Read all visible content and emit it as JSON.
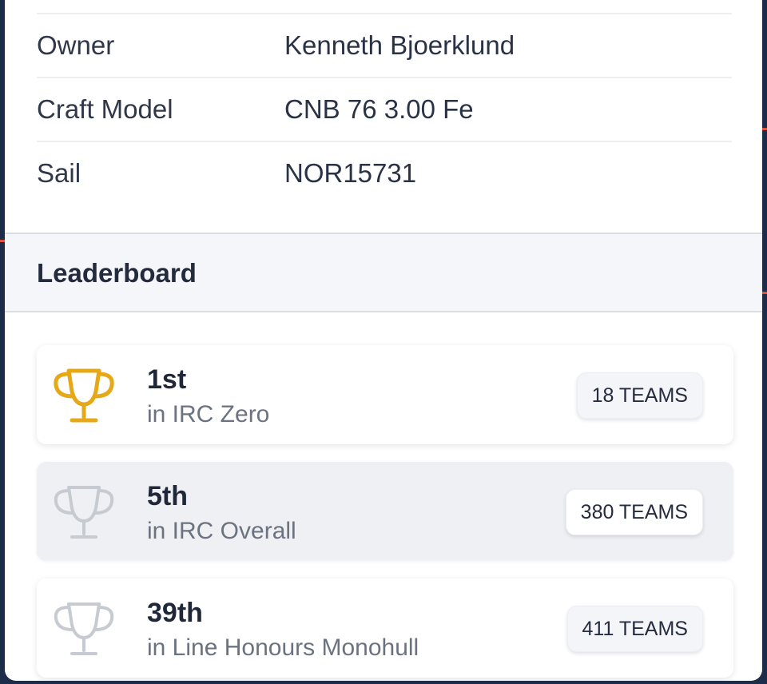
{
  "details": [
    {
      "label": "Owner",
      "value": "Kenneth Bjoerklund"
    },
    {
      "label": "Craft Model",
      "value": "CNB 76 3.00 Fe"
    },
    {
      "label": "Sail",
      "value": "NOR15731"
    }
  ],
  "leaderboard": {
    "title": "Leaderboard",
    "entries": [
      {
        "rank": "1st",
        "division": "in IRC Zero",
        "teams": "18 TEAMS",
        "trophy_color": "#e6a817",
        "trophy_icon": "trophy-gold-icon"
      },
      {
        "rank": "5th",
        "division": "in IRC Overall",
        "teams": "380 TEAMS",
        "trophy_color": "#c6cad1",
        "trophy_icon": "trophy-icon"
      },
      {
        "rank": "39th",
        "division": "in Line Honours Monohull",
        "teams": "411 TEAMS",
        "trophy_color": "#c6cad1",
        "trophy_icon": "trophy-icon"
      }
    ]
  },
  "colors": {
    "accent_gold": "#e6a817",
    "muted_trophy": "#c6cad1",
    "backdrop": "#1d2c48"
  }
}
